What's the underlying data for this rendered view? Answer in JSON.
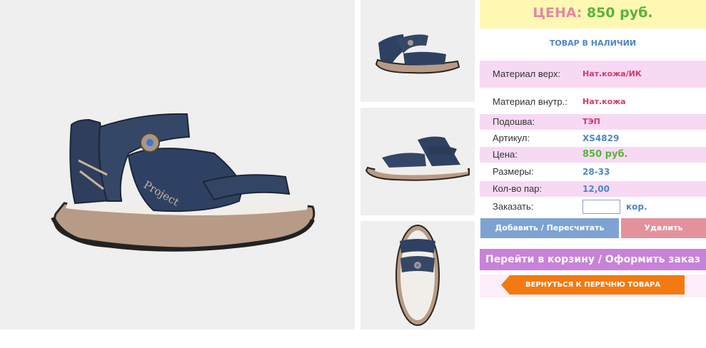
{
  "images": {
    "main": "sandal-side-view",
    "thumbs": [
      "sandal-angle-view",
      "sandal-side-view",
      "sandal-top-view"
    ]
  },
  "price_banner": {
    "label": "ЦЕНА:",
    "value": "850 руб."
  },
  "stock_status": "ТОВАР В НАЛИЧИИ",
  "specs": [
    {
      "key": "Материал верх:",
      "value": "Нат.кожа/ИК"
    },
    {
      "key": "Материал внутр.:",
      "value": "Нат.кожа"
    },
    {
      "key": "Подошва:",
      "value": "ТЭП"
    },
    {
      "key": "Артикул:",
      "value": "XS4829"
    },
    {
      "key": "Цена:",
      "value": "850 руб."
    },
    {
      "key": "Размеры:",
      "value": "28-33"
    },
    {
      "key": "Кол-во пар:",
      "value": "12,00"
    }
  ],
  "order": {
    "label": "Заказать:",
    "input_value": "",
    "unit": "кор."
  },
  "buttons": {
    "add": "Добавить / Пересчитать",
    "delete": "Удалить",
    "cart": "Перейти в корзину / Оформить заказ",
    "back": "ВЕРНУТЬСЯ К ПЕРЕЧНЮ ТОВАРА"
  },
  "colors": {
    "price_label": "#e886a0",
    "price_value": "#5ab33a",
    "accent_blue": "#4e86c4",
    "back_button": "#f37a10"
  }
}
